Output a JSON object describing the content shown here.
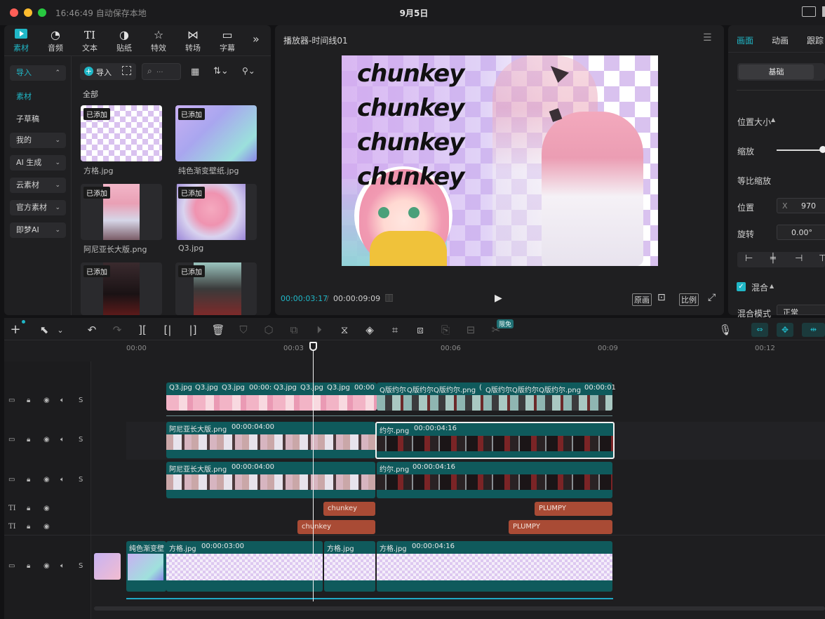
{
  "titlebar": {
    "time_status": "16:46:49 自动保存本地",
    "center_title": "9月5日"
  },
  "media_panel": {
    "tabs": [
      {
        "label": "素材",
        "icon": "media-icon",
        "active": true
      },
      {
        "label": "音频",
        "icon": "audio-icon"
      },
      {
        "label": "文本",
        "icon": "text-icon"
      },
      {
        "label": "贴纸",
        "icon": "sticker-icon"
      },
      {
        "label": "特效",
        "icon": "effects-icon"
      },
      {
        "label": "转场",
        "icon": "transition-icon"
      },
      {
        "label": "字幕",
        "icon": "subtitle-icon"
      }
    ],
    "more": "»",
    "sidebar": [
      {
        "label": "导入",
        "chevron": "⌃",
        "active": true
      },
      {
        "label": "素材"
      },
      {
        "label": "子草稿"
      },
      {
        "label": "我的",
        "chevron": "⌄"
      },
      {
        "label": "AI 生成",
        "chevron": "⌄"
      },
      {
        "label": "云素材",
        "chevron": "⌄"
      },
      {
        "label": "官方素材",
        "chevron": "⌄"
      },
      {
        "label": "即梦AI",
        "chevron": "⌄"
      }
    ],
    "import_button": "导入",
    "search_placeholder": "...",
    "section_label": "全部",
    "added_badge": "已添加",
    "items": [
      {
        "name": "方格.jpg"
      },
      {
        "name": "纯色渐变壁纸.jpg"
      },
      {
        "name": "阿尼亚长大版.png"
      },
      {
        "name": "Q3.jpg"
      },
      {
        "name": ""
      },
      {
        "name": ""
      }
    ]
  },
  "player": {
    "title": "播放器-时间线01",
    "current_time": "00:00:03:17",
    "total_time": "00:00:09:09",
    "original_button": "原画",
    "ratio_button": "比例",
    "preview_text": [
      "chunkey",
      "chunkey",
      "chunkey",
      "chunkey"
    ]
  },
  "inspector": {
    "tabs": [
      "画面",
      "动画",
      "跟踪"
    ],
    "subtab": "基础",
    "section_pos_size": "位置大小",
    "scale_label": "缩放",
    "uniform_scale_label": "等比缩放",
    "position_label": "位置",
    "position_x_label": "X",
    "position_x_value": "970",
    "rotation_label": "旋转",
    "rotation_value": "0.00°",
    "blend_label": "混合",
    "blend_mode_label": "混合模式",
    "blend_mode_value": "正常"
  },
  "toolbar": {
    "free_badge": "限免"
  },
  "ruler": {
    "ticks": [
      "00:00",
      "00:03",
      "00:06",
      "00:09",
      "00:12"
    ]
  },
  "tracks": {
    "sticker_clips": [
      "Q3.jpg",
      "Q3.jpg",
      "Q3.jpg",
      "00:00:",
      "Q3.jpg",
      "Q3.jpg",
      "Q3.jpg",
      "00:00",
      "Q版约尔",
      "Q版约尔",
      "Q版约尔.png",
      "(",
      "Q版约尔",
      "Q版约尔",
      "Q版约尔.png",
      "00:00:01"
    ],
    "video2": [
      {
        "name": "阿尼亚长大版.png",
        "dur": "00:00:04:00"
      },
      {
        "name": "约尔.png",
        "dur": "00:00:04:16"
      }
    ],
    "video3": [
      {
        "name": "阿尼亚长大版.png",
        "dur": "00:00:04:00"
      },
      {
        "name": "约尔.png",
        "dur": "00:00:04:16"
      }
    ],
    "text1": [
      "chunkey",
      "PLUMPY"
    ],
    "text2": [
      "chunkey",
      "PLUMPY"
    ],
    "main": [
      {
        "name": "纯色渐变壁",
        "dur": ""
      },
      {
        "name": "方格.jpg",
        "dur": "00:00:03:00"
      },
      {
        "name": "方格.jpg",
        "dur": ""
      },
      {
        "name": "方格.jpg",
        "dur": "00:00:04:16"
      }
    ],
    "s_label": "S"
  }
}
